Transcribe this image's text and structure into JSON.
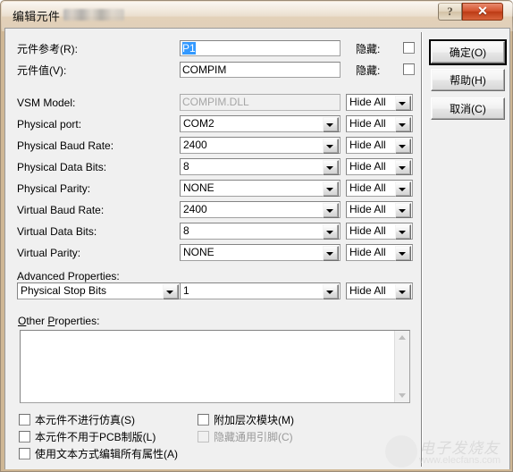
{
  "window": {
    "title": "编辑元件",
    "help_button": "?",
    "close_button": "✕"
  },
  "form": {
    "component_reference_label": "元件参考(R):",
    "component_reference_value": "P1",
    "component_value_label": "元件值(V):",
    "component_value_value": "COMPIM",
    "hide_label": "隐藏:",
    "rows": [
      {
        "label": "VSM Model:",
        "value": "COMPIM.DLL",
        "hide": "Hide All",
        "readonly": true
      },
      {
        "label": "Physical port:",
        "value": "COM2",
        "hide": "Hide All",
        "readonly": false
      },
      {
        "label": "Physical Baud Rate:",
        "value": "2400",
        "hide": "Hide All",
        "readonly": false
      },
      {
        "label": "Physical Data Bits:",
        "value": "8",
        "hide": "Hide All",
        "readonly": false
      },
      {
        "label": "Physical Parity:",
        "value": "NONE",
        "hide": "Hide All",
        "readonly": false
      },
      {
        "label": "Virtual Baud Rate:",
        "value": "2400",
        "hide": "Hide All",
        "readonly": false
      },
      {
        "label": "Virtual Data Bits:",
        "value": "8",
        "hide": "Hide All",
        "readonly": false
      },
      {
        "label": "Virtual Parity:",
        "value": "NONE",
        "hide": "Hide All",
        "readonly": false
      }
    ],
    "advanced_properties_label": "Advanced Properties:",
    "advanced_property_name": "Physical Stop Bits",
    "advanced_property_value": "1",
    "advanced_property_hide": "Hide All",
    "other_properties_label": "Other Properties:",
    "other_properties_value": ""
  },
  "checkboxes": {
    "no_simulate": "本元件不进行仿真(S)",
    "no_pcb": "本元件不用于PCB制版(L)",
    "edit_all_as_text": "使用文本方式编辑所有属性(A)",
    "attach_hierarchy_module": "附加层次模块(M)",
    "hide_common_pins": "隐藏通用引脚(C)"
  },
  "buttons": {
    "ok": "确定(O)",
    "help": "帮助(H)",
    "cancel": "取消(C)"
  },
  "watermark": {
    "name": "电子发烧友",
    "url": "www.elecfans.com"
  },
  "colors": {
    "frame": "#d8c3a6",
    "client": "#f0f0f0",
    "selection": "#3399ff",
    "close_button": "#c0391a"
  }
}
